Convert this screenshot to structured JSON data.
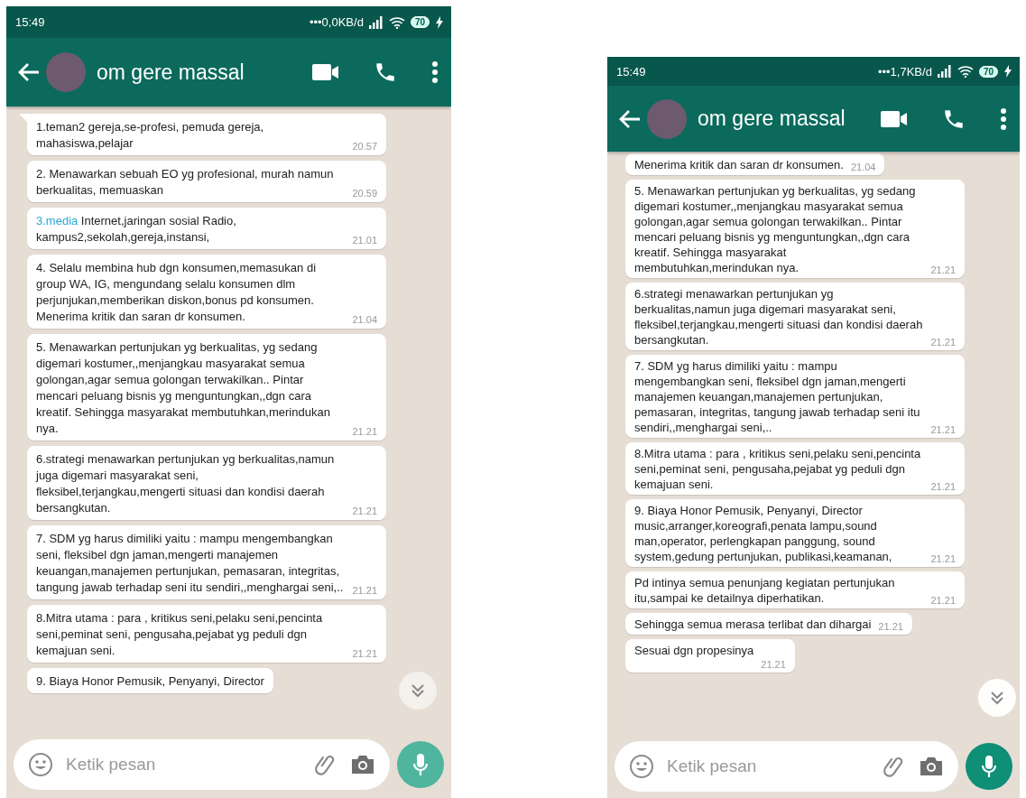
{
  "phones": [
    {
      "status_bar": {
        "time": "15:49",
        "network_speed": "•••0,0KB/d",
        "battery": "70"
      },
      "header": {
        "title": "om gere massal"
      },
      "messages": [
        {
          "text": "1.teman2 gereja,se-profesi, pemuda gereja, mahasiswa,pelajar",
          "time": "20.57",
          "tail": true
        },
        {
          "text": "2. Menawarkan sebuah EO yg profesional, murah namun berkualitas, memuaskan",
          "time": "20.59",
          "tail": false
        },
        {
          "link": "3.media",
          "text": " Internet,jaringan sosial Radio, kampus2,sekolah,gereja,instansi,",
          "time": "21.01",
          "tail": false
        },
        {
          "text": "4. Selalu membina hub dgn konsumen,memasukan di group WA, IG, mengundang selalu konsumen dlm perjunjukan,memberikan diskon,bonus pd konsumen. Menerima kritik dan saran dr konsumen.",
          "time": "21.04",
          "tail": false
        },
        {
          "text": "5. Menawarkan pertunjukan yg berkualitas, yg sedang digemari kostumer,,menjangkau masyarakat semua golongan,agar semua golongan terwakilkan.. Pintar mencari peluang bisnis yg menguntungkan,,dgn cara kreatif. Sehingga masyarakat membutuhkan,merindukan nya.",
          "time": "21.21",
          "tail": false
        },
        {
          "text": "6.strategi menawarkan pertunjukan yg berkualitas,namun juga digemari masyarakat seni, fleksibel,terjangkau,mengerti situasi dan kondisi daerah bersangkutan.",
          "time": "21.21",
          "tail": false
        },
        {
          "text": "7. SDM yg harus dimiliki yaitu : mampu mengembangkan seni, fleksibel dgn jaman,mengerti manajemen keuangan,manajemen pertunjukan, pemasaran, integritas, tangung jawab terhadap seni itu sendiri,,menghargai seni,..",
          "time": "21.21",
          "tail": false
        },
        {
          "text": "8.Mitra utama : para , kritikus seni,pelaku seni,pencinta seni,peminat seni, pengusaha,pejabat yg peduli dgn kemajuan seni.",
          "time": "21.21",
          "tail": false
        },
        {
          "text": "9. Biaya Honor Pemusik, Penyanyi, Director",
          "tail": false
        }
      ],
      "input": {
        "placeholder": "Ketik pesan"
      },
      "scroll_down": true
    },
    {
      "status_bar": {
        "time": "15:49",
        "network_speed": "•••1,7KB/d",
        "battery": "70"
      },
      "header": {
        "title": "om gere massal"
      },
      "messages": [
        {
          "text": "Menerima kritik dan saran dr konsumen.",
          "time": "21.04",
          "tail": false
        },
        {
          "text": "5. Menawarkan pertunjukan yg berkualitas, yg sedang digemari kostumer,,menjangkau masyarakat semua golongan,agar semua golongan terwakilkan.. Pintar mencari peluang bisnis yg menguntungkan,,dgn cara kreatif. Sehingga masyarakat membutuhkan,merindukan nya.",
          "time": "21.21",
          "tail": false
        },
        {
          "text": "6.strategi menawarkan pertunjukan yg berkualitas,namun juga digemari masyarakat seni, fleksibel,terjangkau,mengerti situasi dan kondisi daerah bersangkutan.",
          "time": "21.21",
          "tail": false
        },
        {
          "text": "7. SDM yg harus dimiliki yaitu : mampu mengembangkan seni, fleksibel dgn jaman,mengerti manajemen keuangan,manajemen pertunjukan, pemasaran, integritas, tangung jawab terhadap seni itu sendiri,,menghargai seni,..",
          "time": "21.21",
          "tail": false
        },
        {
          "text": "8.Mitra utama : para , kritikus seni,pelaku seni,pencinta seni,peminat seni, pengusaha,pejabat yg peduli dgn kemajuan seni.",
          "time": "21.21",
          "tail": false
        },
        {
          "text": "9. Biaya Honor Pemusik, Penyanyi, Director music,arranger,koreografi,penata lampu,sound man,operator, perlengkapan panggung, sound system,gedung pertunjukan, publikasi,keamanan,",
          "time": "21.21",
          "tail": false
        },
        {
          "text": "Pd intinya semua penunjang kegiatan pertunjukan itu,sampai ke detailnya diperhatikan.",
          "time": "21.21",
          "tail": false
        },
        {
          "text": "Sehingga semua merasa terlibat dan dihargai",
          "time": "21.21",
          "tail": false
        },
        {
          "text": "Sesuai dgn propesinya",
          "time": "21.21",
          "tail": false
        }
      ],
      "input": {
        "placeholder": "Ketik pesan"
      },
      "scroll_down": true
    }
  ]
}
